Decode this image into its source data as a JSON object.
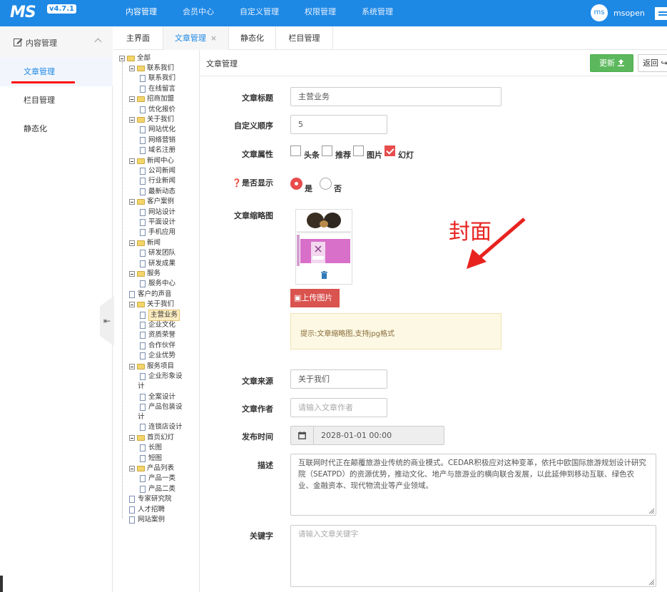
{
  "app": {
    "logo": "MS",
    "version": "v4.7.1",
    "brand_color": "#1e88e5"
  },
  "topnav": [
    "内容管理",
    "会员中心",
    "自定义管理",
    "权限管理",
    "系统管理"
  ],
  "user": {
    "avatar": "ms",
    "name": "msopen"
  },
  "sidebar": {
    "group_label": "内容管理",
    "items": [
      {
        "label": "文章管理"
      },
      {
        "label": "栏目管理"
      },
      {
        "label": "静态化"
      }
    ]
  },
  "tabs": [
    {
      "label": "主界面"
    },
    {
      "label": "文章管理",
      "close": "×"
    },
    {
      "label": "静态化"
    },
    {
      "label": "栏目管理"
    }
  ],
  "tree": {
    "root": "全部",
    "nodes": [
      "联系我们",
      "联系我们",
      "在线留言",
      "招商加盟",
      "优化报价",
      "关于我们",
      "网站优化",
      "网络营销",
      "域名注册",
      "新闻中心",
      "公司新闻",
      "行业新闻",
      "最新动态",
      "客户案例",
      "网站设计",
      "平面设计",
      "手机应用",
      "新闻",
      "研发团队",
      "研发成果",
      "服务",
      "服务中心",
      "客户的声音",
      "关于我们",
      "主营业务",
      "企业文化",
      "资质荣誉",
      "合作伙伴",
      "企业优势",
      "服务项目",
      "企业形象设计",
      "全案设计",
      "产品包装设计",
      "连锁店设计",
      "首页幻灯",
      "长图",
      "短图",
      "产品列表",
      "产品一类",
      "产品二类",
      "专家研究院",
      "人才招聘",
      "网站案例"
    ]
  },
  "main": {
    "title": "文章管理",
    "update_label": "更新",
    "back_label": "返回",
    "form": {
      "title_label": "文章标题",
      "title_value": "主营业务",
      "order_label": "自定义顺序",
      "order_value": "5",
      "attr_label": "文章属性",
      "attrs": [
        {
          "label": "头条",
          "checked": false
        },
        {
          "label": "推荐",
          "checked": false
        },
        {
          "label": "图片",
          "checked": false
        },
        {
          "label": "幻灯",
          "checked": true
        }
      ],
      "display_label": "是否显示",
      "display_yes": "是",
      "display_no": "否",
      "display_value": "是",
      "thumb_label": "文章缩略图",
      "upload_label": "上传图片",
      "tip": "提示:文章缩略图,支持jpg格式",
      "annotation": "封面",
      "source_label": "文章来源",
      "source_value": "关于我们",
      "author_label": "文章作者",
      "author_placeholder": "请输入文章作者",
      "date_label": "发布时间",
      "date_value": "2028-01-01 00:00",
      "desc_label": "描述",
      "desc_value": "互联网时代正在颠覆旅游业传统的商业模式。CEDAR积极应对这种变革，依托中欧国际旅游规划设计研究院（SEATPD）的资源优势，推动文化、地产与旅游业的横向联合发展，以此延伸到移动互联、绿色农业、金融资本、现代物流业等产业领域。",
      "keyword_label": "关键字",
      "keyword_placeholder": "请输入文章关键字"
    }
  },
  "colors": {
    "accent": "#1e88e5",
    "success": "#5cb85c",
    "danger": "#d9534f",
    "checked": "#e84c4c",
    "annotation": "#e8231f"
  }
}
